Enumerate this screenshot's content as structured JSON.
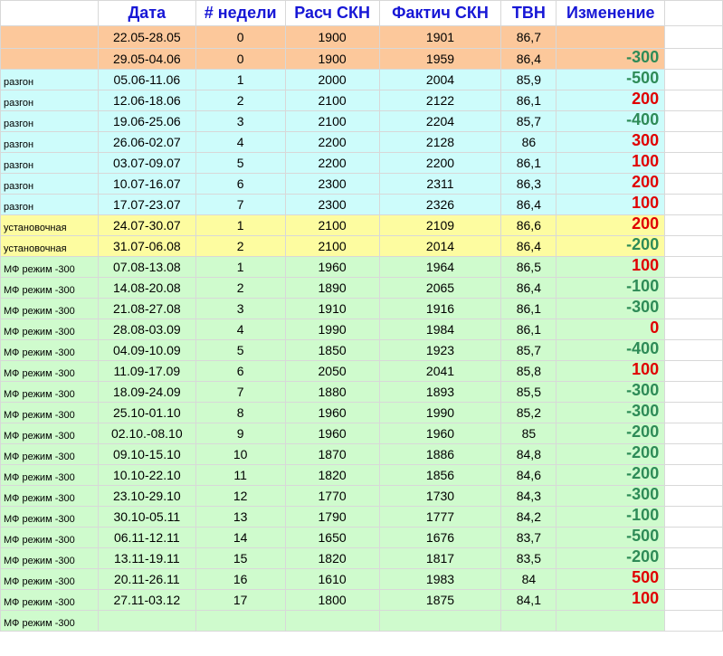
{
  "headers": [
    "Дата",
    "# недели",
    "Расч СКН",
    "Фактич СКН",
    "ТВН",
    "Изменение"
  ],
  "rows": [
    {
      "group": "orange",
      "label": "",
      "date": "22.05-28.05",
      "week": "0",
      "calc": "1900",
      "fact": "1901",
      "tvn": "86,7",
      "change": "",
      "sign": ""
    },
    {
      "group": "orange",
      "label": "",
      "date": "29.05-04.06",
      "week": "0",
      "calc": "1900",
      "fact": "1959",
      "tvn": "86,4",
      "change": "-300",
      "sign": "neg"
    },
    {
      "group": "cyan",
      "label": "разгон",
      "date": "05.06-11.06",
      "week": "1",
      "calc": "2000",
      "fact": "2004",
      "tvn": "85,9",
      "change": "-500",
      "sign": "neg"
    },
    {
      "group": "cyan",
      "label": "разгон",
      "date": "12.06-18.06",
      "week": "2",
      "calc": "2100",
      "fact": "2122",
      "tvn": "86,1",
      "change": "200",
      "sign": "pos"
    },
    {
      "group": "cyan",
      "label": "разгон",
      "date": "19.06-25.06",
      "week": "3",
      "calc": "2100",
      "fact": "2204",
      "tvn": "85,7",
      "change": "-400",
      "sign": "neg"
    },
    {
      "group": "cyan",
      "label": "разгон",
      "date": "26.06-02.07",
      "week": "4",
      "calc": "2200",
      "fact": "2128",
      "tvn": "86",
      "change": "300",
      "sign": "pos"
    },
    {
      "group": "cyan",
      "label": "разгон",
      "date": "03.07-09.07",
      "week": "5",
      "calc": "2200",
      "fact": "2200",
      "tvn": "86,1",
      "change": "100",
      "sign": "pos"
    },
    {
      "group": "cyan",
      "label": "разгон",
      "date": "10.07-16.07",
      "week": "6",
      "calc": "2300",
      "fact": "2311",
      "tvn": "86,3",
      "change": "200",
      "sign": "pos"
    },
    {
      "group": "cyan",
      "label": "разгон",
      "date": "17.07-23.07",
      "week": "7",
      "calc": "2300",
      "fact": "2326",
      "tvn": "86,4",
      "change": "100",
      "sign": "pos"
    },
    {
      "group": "yellow",
      "label": "установочная",
      "date": "24.07-30.07",
      "week": "1",
      "calc": "2100",
      "fact": "2109",
      "tvn": "86,6",
      "change": "200",
      "sign": "pos"
    },
    {
      "group": "yellow",
      "label": "установочная",
      "date": "31.07-06.08",
      "week": "2",
      "calc": "2100",
      "fact": "2014",
      "tvn": "86,4",
      "change": "-200",
      "sign": "neg"
    },
    {
      "group": "green",
      "label": "МФ режим -300",
      "date": "07.08-13.08",
      "week": "1",
      "calc": "1960",
      "fact": "1964",
      "tvn": "86,5",
      "change": "100",
      "sign": "pos"
    },
    {
      "group": "green",
      "label": "МФ режим -300",
      "date": "14.08-20.08",
      "week": "2",
      "calc": "1890",
      "fact": "2065",
      "tvn": "86,4",
      "change": "-100",
      "sign": "neg"
    },
    {
      "group": "green",
      "label": "МФ режим -300",
      "date": "21.08-27.08",
      "week": "3",
      "calc": "1910",
      "fact": "1916",
      "tvn": "86,1",
      "change": "-300",
      "sign": "neg"
    },
    {
      "group": "green",
      "label": "МФ режим -300",
      "date": "28.08-03.09",
      "week": "4",
      "calc": "1990",
      "fact": "1984",
      "tvn": "86,1",
      "change": "0",
      "sign": "pos"
    },
    {
      "group": "green",
      "label": "МФ режим -300",
      "date": "04.09-10.09",
      "week": "5",
      "calc": "1850",
      "fact": "1923",
      "tvn": "85,7",
      "change": "-400",
      "sign": "neg"
    },
    {
      "group": "green",
      "label": "МФ режим -300",
      "date": "11.09-17.09",
      "week": "6",
      "calc": "2050",
      "fact": "2041",
      "tvn": "85,8",
      "change": "100",
      "sign": "pos"
    },
    {
      "group": "green",
      "label": "МФ режим -300",
      "date": "18.09-24.09",
      "week": "7",
      "calc": "1880",
      "fact": "1893",
      "tvn": "85,5",
      "change": "-300",
      "sign": "neg"
    },
    {
      "group": "green",
      "label": "МФ режим -300",
      "date": "25.10-01.10",
      "week": "8",
      "calc": "1960",
      "fact": "1990",
      "tvn": "85,2",
      "change": "-300",
      "sign": "neg"
    },
    {
      "group": "green",
      "label": "МФ режим -300",
      "date": "02.10.-08.10",
      "week": "9",
      "calc": "1960",
      "fact": "1960",
      "tvn": "85",
      "change": "-200",
      "sign": "neg"
    },
    {
      "group": "green",
      "label": "МФ режим -300",
      "date": "09.10-15.10",
      "week": "10",
      "calc": "1870",
      "fact": "1886",
      "tvn": "84,8",
      "change": "-200",
      "sign": "neg"
    },
    {
      "group": "green",
      "label": "МФ режим -300",
      "date": "10.10-22.10",
      "week": "11",
      "calc": "1820",
      "fact": "1856",
      "tvn": "84,6",
      "change": "-200",
      "sign": "neg"
    },
    {
      "group": "green",
      "label": "МФ режим -300",
      "date": "23.10-29.10",
      "week": "12",
      "calc": "1770",
      "fact": "1730",
      "tvn": "84,3",
      "change": "-300",
      "sign": "neg"
    },
    {
      "group": "green",
      "label": "МФ режим -300",
      "date": "30.10-05.11",
      "week": "13",
      "calc": "1790",
      "fact": "1777",
      "tvn": "84,2",
      "change": "-100",
      "sign": "neg"
    },
    {
      "group": "green",
      "label": "МФ режим -300",
      "date": "06.11-12.11",
      "week": "14",
      "calc": "1650",
      "fact": "1676",
      "tvn": "83,7",
      "change": "-500",
      "sign": "neg"
    },
    {
      "group": "green",
      "label": "МФ режим -300",
      "date": "13.11-19.11",
      "week": "15",
      "calc": "1820",
      "fact": "1817",
      "tvn": "83,5",
      "change": "-200",
      "sign": "neg"
    },
    {
      "group": "green",
      "label": "МФ режим -300",
      "date": "20.11-26.11",
      "week": "16",
      "calc": "1610",
      "fact": "1983",
      "tvn": "84",
      "change": "500",
      "sign": "pos"
    },
    {
      "group": "green",
      "label": "МФ режим -300",
      "date": "27.11-03.12",
      "week": "17",
      "calc": "1800",
      "fact": "1875",
      "tvn": "84,1",
      "change": "100",
      "sign": "pos"
    },
    {
      "group": "green",
      "label": "МФ режим -300",
      "date": "",
      "week": "",
      "calc": "",
      "fact": "",
      "tvn": "",
      "change": "",
      "sign": ""
    }
  ]
}
